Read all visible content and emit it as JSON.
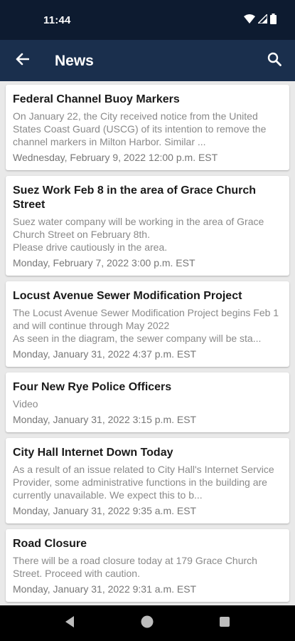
{
  "status_bar": {
    "time": "11:44",
    "icons": [
      "wifi-icon",
      "cell-signal-icon",
      "battery-icon"
    ]
  },
  "app_bar": {
    "title": "News",
    "back_icon": "arrow-back-icon",
    "search_icon": "search-icon",
    "background_color": "#1a2f4d"
  },
  "news": [
    {
      "title": "Federal Channel Buoy Markers",
      "summary": "On January 22, the City received notice from the United States Coast Guard (USCG) of its intention to remove the channel markers in Milton Harbor. Similar ...",
      "date": "Wednesday, February 9, 2022 12:00 p.m. EST"
    },
    {
      "title": "Suez Work Feb 8 in the area of Grace Church Street",
      "summary": "Suez water company will be working in the area of Grace Church Street on February 8th.\nPlease drive cautiously in the area.",
      "date": "Monday, February 7, 2022 3:00 p.m. EST"
    },
    {
      "title": "Locust Avenue Sewer Modification Project",
      "summary": "The Locust Avenue Sewer Modification Project begins Feb 1 and will continue through May 2022\nAs seen in the diagram, the sewer company will be sta...",
      "date": "Monday, January 31, 2022 4:37 p.m. EST"
    },
    {
      "title": "Four New Rye Police Officers",
      "summary": "Video",
      "date": "Monday, January 31, 2022 3:15 p.m. EST"
    },
    {
      "title": "City Hall Internet Down Today",
      "summary": "As a result of an issue related to City Hall's Internet Service Provider, some administrative functions in the building are currently unavailable. We expect this to b...",
      "date": "Monday, January 31, 2022 9:35 a.m. EST"
    },
    {
      "title": "Road Closure",
      "summary": "There will be a road closure today at 179 Grace Church Street. Proceed with caution.",
      "date": "Monday, January 31, 2022 9:31 a.m. EST"
    }
  ],
  "nav_bar": {
    "icons": [
      "nav-back-icon",
      "nav-home-icon",
      "nav-recents-icon"
    ]
  }
}
